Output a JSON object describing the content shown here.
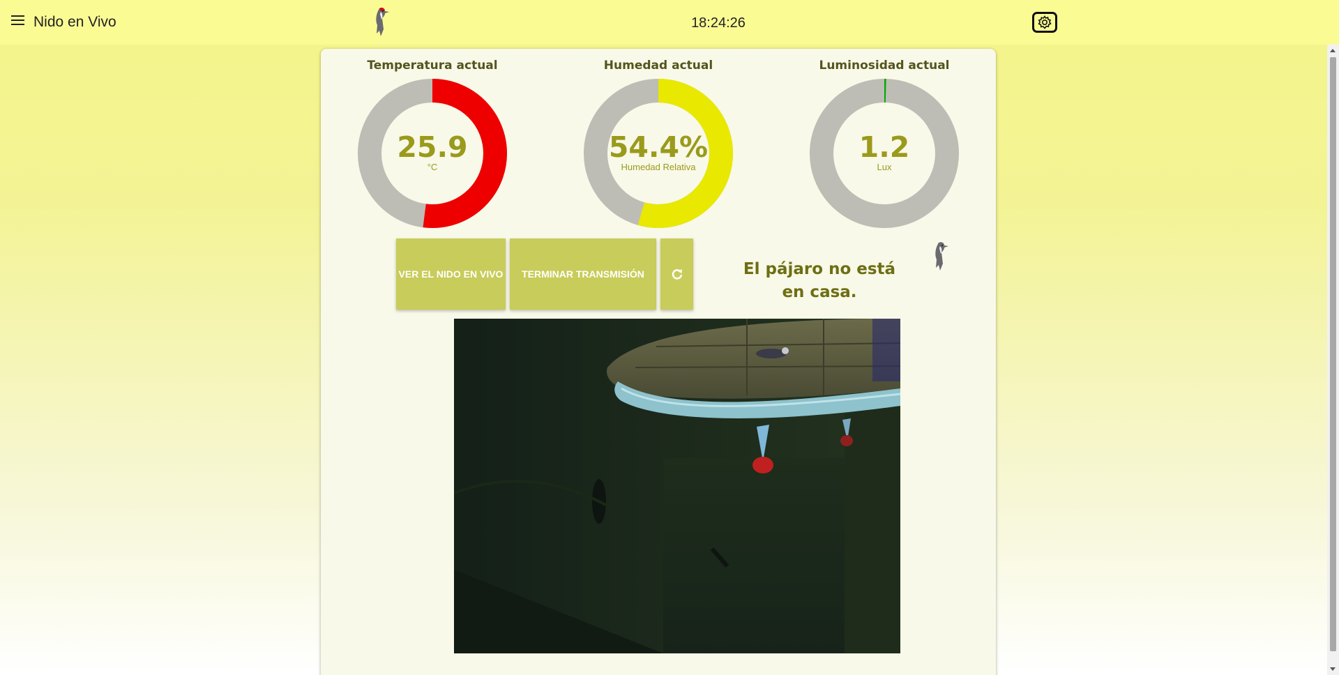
{
  "header": {
    "title": "Nido en Vivo",
    "clock": "18:24:26",
    "menu_icon": "hamburger-icon",
    "settings_icon": "gear-icon"
  },
  "gauges": [
    {
      "title": "Temperatura actual",
      "value": "25.9",
      "unit": "°C",
      "fill": 0.52,
      "color": "#ee0000"
    },
    {
      "title": "Humedad actual",
      "value": "54.4%",
      "unit": "Humedad Relativa",
      "fill": 0.544,
      "color": "#e8e800"
    },
    {
      "title": "Luminosidad actual",
      "value": "1.2",
      "unit": "Lux",
      "fill": 0.003,
      "color": "#00aa00"
    }
  ],
  "controls": {
    "view_live_label": "VER EL NIDO EN VIVO",
    "end_stream_label": "TERMINAR TRANSMISIÓN",
    "refresh_icon": "refresh-icon"
  },
  "status": {
    "message": "El pájaro no está en casa."
  },
  "colors": {
    "accent": "#c8cc5a",
    "header_bg": "#fbfb94",
    "gauge_track": "#bdbdb6",
    "value_text": "#9a9a1c"
  }
}
